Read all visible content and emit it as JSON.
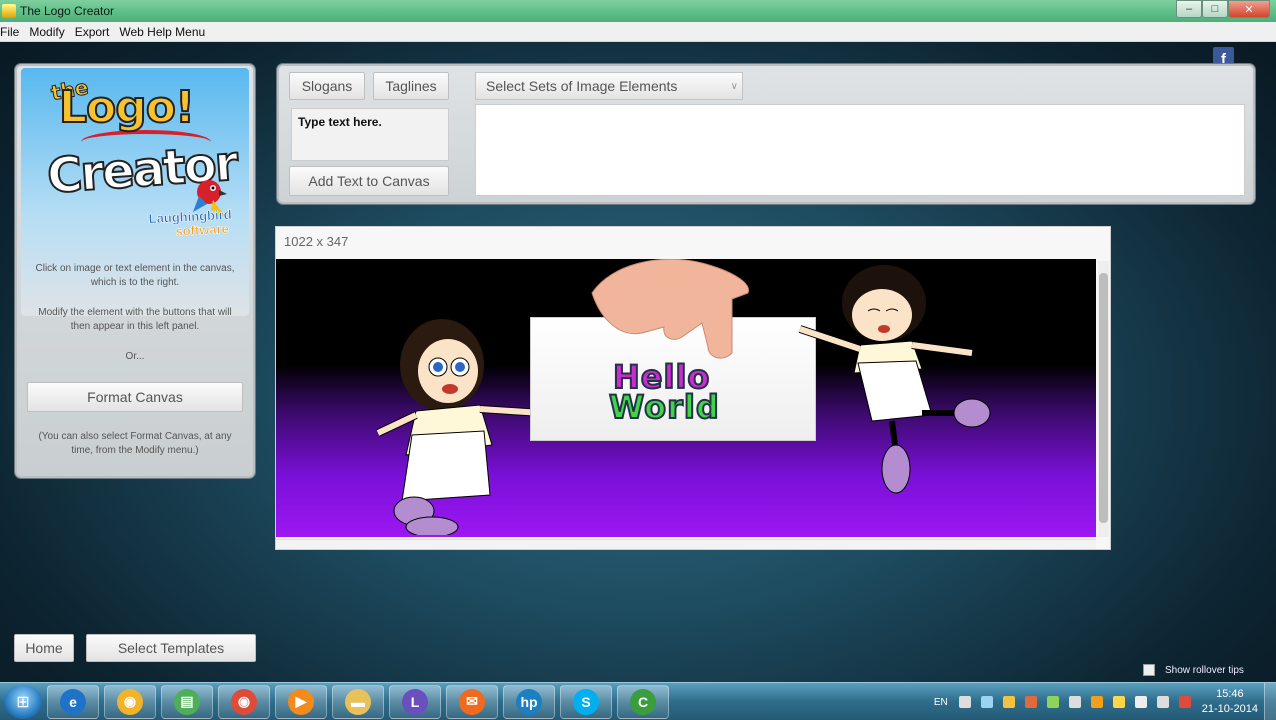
{
  "window": {
    "title": "The Logo Creator",
    "minimize": "–",
    "maximize": "□",
    "close": "✕"
  },
  "menu": [
    "File",
    "Modify",
    "Export",
    "Web Help Menu"
  ],
  "social": {
    "facebook": "f"
  },
  "logo": {
    "the": "the",
    "word": "Logo!",
    "creator": "Creator",
    "brand_top": "Laughingbird",
    "brand_bottom": "software"
  },
  "left_panel": {
    "instruction_1": "Click on image or text element in the canvas, which is to the right.",
    "instruction_2": "Modify the element with the buttons that will then appear in this left panel.",
    "or": "Or...",
    "format_canvas": "Format Canvas",
    "note": "(You can also select Format Canvas, at any time, from the Modify menu.)"
  },
  "top_panel": {
    "slogans": "Slogans",
    "taglines": "Taglines",
    "text_placeholder": "Type text here.",
    "add_text": "Add Text to Canvas",
    "image_sets": "Select Sets of Image Elements"
  },
  "canvas": {
    "size": "1022 x 347",
    "line1": "Hello",
    "line2": "World",
    "gradient_colors": [
      "#000000",
      "#7a10d8",
      "#9d17f2"
    ]
  },
  "bottom": {
    "home": "Home",
    "templates": "Select Templates",
    "show_tips": "Show rollover tips"
  },
  "taskbar": {
    "lang": "EN",
    "time": "15:46",
    "date": "21-10-2014",
    "apps": [
      {
        "name": "internet-explorer-icon",
        "color": "#1e73c8",
        "glyph": "e"
      },
      {
        "name": "chrome-canary-icon",
        "color": "#f2b32a",
        "glyph": "◉"
      },
      {
        "name": "file-manager-icon",
        "color": "#4fae58",
        "glyph": "▤"
      },
      {
        "name": "chrome-icon",
        "color": "#dd4b39",
        "glyph": "◉"
      },
      {
        "name": "media-player-icon",
        "color": "#f28a1c",
        "glyph": "▶"
      },
      {
        "name": "folder-icon",
        "color": "#e9c15a",
        "glyph": "▬"
      },
      {
        "name": "logo-creator-icon",
        "color": "#6a4fbf",
        "glyph": "L"
      },
      {
        "name": "mail-icon",
        "color": "#ef6a1d",
        "glyph": "✉"
      },
      {
        "name": "hp-icon",
        "color": "#1b7fc1",
        "glyph": "hp"
      },
      {
        "name": "skype-icon",
        "color": "#00aff0",
        "glyph": "S"
      },
      {
        "name": "camtasia-icon",
        "color": "#3a9d3e",
        "glyph": "C"
      }
    ]
  }
}
